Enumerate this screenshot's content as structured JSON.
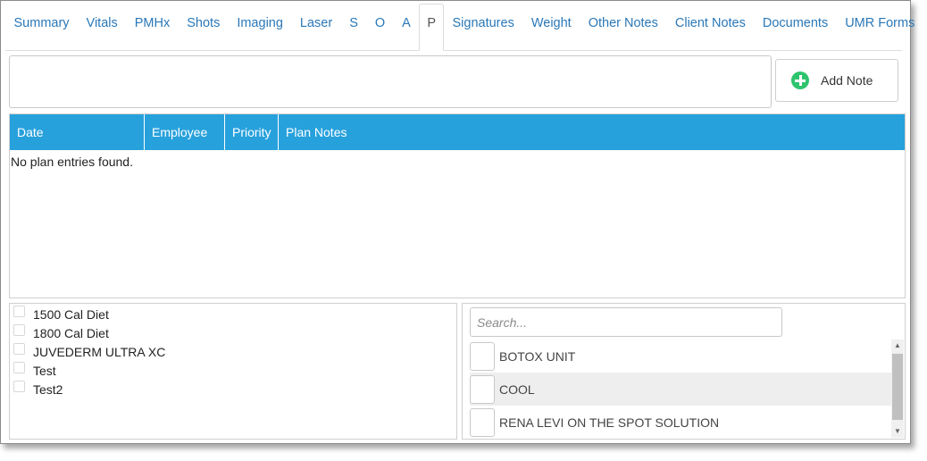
{
  "tabs": [
    {
      "label": "Summary",
      "active": false
    },
    {
      "label": "Vitals",
      "active": false
    },
    {
      "label": "PMHx",
      "active": false
    },
    {
      "label": "Shots",
      "active": false
    },
    {
      "label": "Imaging",
      "active": false
    },
    {
      "label": "Laser",
      "active": false
    },
    {
      "label": "S",
      "active": false
    },
    {
      "label": "O",
      "active": false
    },
    {
      "label": "A",
      "active": false
    },
    {
      "label": "P",
      "active": true
    },
    {
      "label": "Signatures",
      "active": false
    },
    {
      "label": "Weight",
      "active": false
    },
    {
      "label": "Other Notes",
      "active": false
    },
    {
      "label": "Client Notes",
      "active": false
    },
    {
      "label": "Documents",
      "active": false
    },
    {
      "label": "UMR Forms",
      "active": false
    }
  ],
  "note": {
    "value": "",
    "add_label": "Add Note"
  },
  "grid": {
    "columns": [
      "Date",
      "Employee",
      "Priority",
      "Plan Notes"
    ],
    "empty_message": "No plan entries found.",
    "header_color": "#27a1dc"
  },
  "checklist": [
    {
      "label": "1500 Cal Diet",
      "checked": false
    },
    {
      "label": "1800 Cal Diet",
      "checked": false
    },
    {
      "label": "JUVEDERM ULTRA XC",
      "checked": false
    },
    {
      "label": "Test",
      "checked": false
    },
    {
      "label": "Test2",
      "checked": false
    }
  ],
  "search": {
    "placeholder": "Search...",
    "options": [
      {
        "label": "BOTOX UNIT",
        "highlighted": false
      },
      {
        "label": "COOL",
        "highlighted": true
      },
      {
        "label": "RENA LEVI ON THE SPOT SOLUTION",
        "highlighted": false
      }
    ]
  }
}
